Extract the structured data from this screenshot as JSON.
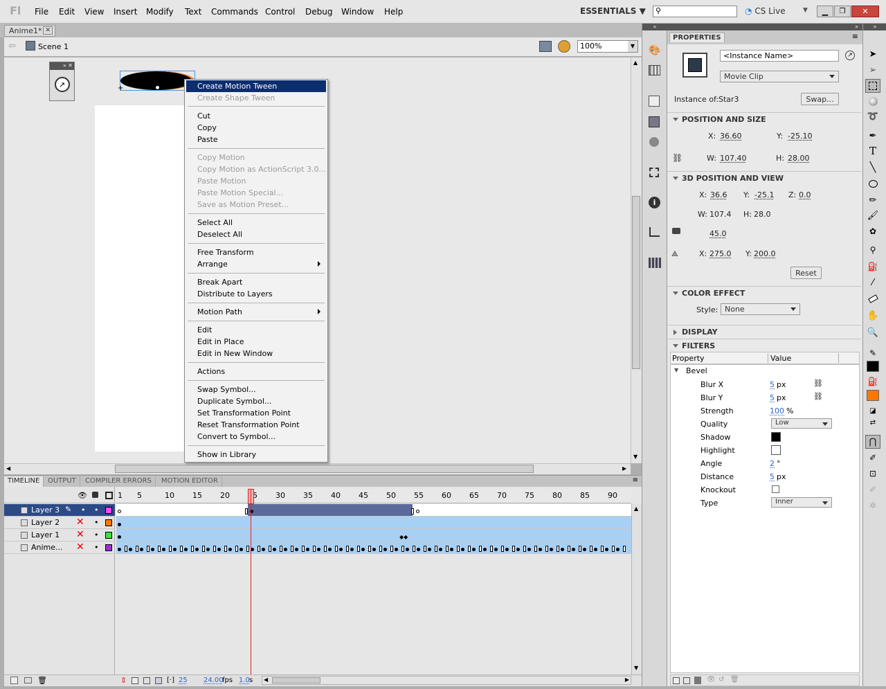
{
  "app": {
    "logo": "Fl",
    "menu": [
      "File",
      "Edit",
      "View",
      "Insert",
      "Modify",
      "Text",
      "Commands",
      "Control",
      "Debug",
      "Window",
      "Help"
    ],
    "workspace": "ESSENTIALS",
    "search_placeholder": "",
    "cs_live": "CS Live"
  },
  "document": {
    "tab": "Anime1*",
    "scene": "Scene 1",
    "zoom": "100%"
  },
  "context_menu": {
    "items": [
      {
        "label": "Create Motion Tween",
        "state": "highlighted"
      },
      {
        "label": "Create Shape Tween",
        "state": "disabled"
      },
      {
        "label": "Cut"
      },
      {
        "label": "Copy"
      },
      {
        "label": "Paste"
      },
      {
        "label": "Copy Motion",
        "state": "disabled"
      },
      {
        "label": "Copy Motion as ActionScript 3.0...",
        "state": "disabled"
      },
      {
        "label": "Paste Motion",
        "state": "disabled"
      },
      {
        "label": "Paste Motion Special...",
        "state": "disabled"
      },
      {
        "label": "Save as Motion Preset...",
        "state": "disabled"
      },
      {
        "label": "Select All"
      },
      {
        "label": "Deselect All"
      },
      {
        "label": "Free Transform"
      },
      {
        "label": "Arrange"
      },
      {
        "label": "Break Apart"
      },
      {
        "label": "Distribute to Layers"
      },
      {
        "label": "Motion Path"
      },
      {
        "label": "Edit"
      },
      {
        "label": "Edit in Place"
      },
      {
        "label": "Edit in New Window"
      },
      {
        "label": "Actions"
      },
      {
        "label": "Swap Symbol..."
      },
      {
        "label": "Duplicate Symbol..."
      },
      {
        "label": "Set Transformation Point"
      },
      {
        "label": "Reset Transformation Point"
      },
      {
        "label": "Convert to Symbol..."
      },
      {
        "label": "Show in Library"
      }
    ]
  },
  "timeline": {
    "tabs": [
      "TIMELINE",
      "OUTPUT",
      "COMPILER ERRORS",
      "MOTION EDITOR"
    ],
    "ruler": [
      "1",
      "5",
      "10",
      "15",
      "20",
      "25",
      "30",
      "35",
      "40",
      "45",
      "50",
      "55",
      "60",
      "65",
      "70",
      "75",
      "80",
      "85",
      "90"
    ],
    "layers": [
      {
        "name": "Layer 3",
        "color": "#ff44ff",
        "selected": true
      },
      {
        "name": "Layer 2",
        "color": "#ff7700"
      },
      {
        "name": "Layer 1",
        "color": "#44dd44"
      },
      {
        "name": "Anime...",
        "color": "#9933cc"
      }
    ],
    "current_frame": "25",
    "fps": "24.00",
    "fps_unit": "fps",
    "time": "1.0",
    "time_unit": "s"
  },
  "properties": {
    "title": "PROPERTIES",
    "instance_name_placeholder": "<Instance Name>",
    "symbol_type": "Movie Clip",
    "instance_of_label": "Instance of:",
    "instance_of": "Star3",
    "swap": "Swap...",
    "pos_size": {
      "title": "POSITION AND SIZE",
      "x": "36.60",
      "y": "-25.10",
      "w": "107.40",
      "h": "28.00"
    },
    "view3d": {
      "title": "3D POSITION AND VIEW",
      "x": "36.6",
      "y": "-25.1",
      "z": "0.0",
      "w": "107.4",
      "h": "28.0",
      "persp": "45.0",
      "vx": "275.0",
      "vy": "200.0",
      "reset": "Reset"
    },
    "color_effect": {
      "title": "COLOR EFFECT",
      "style_label": "Style:",
      "style": "None"
    },
    "display": {
      "title": "DISPLAY"
    },
    "filters": {
      "title": "FILTERS",
      "col_property": "Property",
      "col_value": "Value",
      "filter": "Bevel",
      "rows": [
        {
          "name": "Blur X",
          "value": "5",
          "unit": "px"
        },
        {
          "name": "Blur Y",
          "value": "5",
          "unit": "px"
        },
        {
          "name": "Strength",
          "value": "100",
          "unit": "%"
        },
        {
          "name": "Quality",
          "value": "Low"
        },
        {
          "name": "Shadow"
        },
        {
          "name": "Highlight"
        },
        {
          "name": "Angle",
          "value": "2",
          "unit": "°"
        },
        {
          "name": "Distance",
          "value": "5",
          "unit": "px"
        },
        {
          "name": "Knockout"
        },
        {
          "name": "Type",
          "value": "Inner"
        }
      ]
    }
  },
  "labels": {
    "x": "X:",
    "y": "Y:",
    "z": "Z:",
    "w": "W:",
    "h": "H:"
  },
  "colors": {
    "accent_highlight": "#0c2d6e",
    "playhead": "#dd2222",
    "tween_span": "#5a6a9a",
    "frame_row": "#a8d0f4",
    "fill_color": "#ff7700"
  }
}
